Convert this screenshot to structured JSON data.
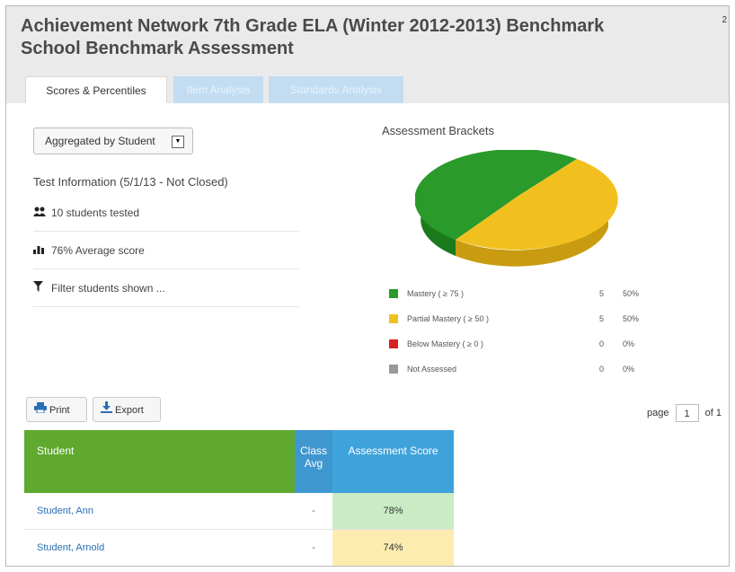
{
  "header": {
    "title_line1": "Achievement Network 7th Grade ELA (Winter 2012-2013) Benchmark",
    "title_line2": "School Benchmark Assessment",
    "corner_text": "2"
  },
  "tabs": [
    {
      "label": "Scores & Percentiles",
      "active": true
    },
    {
      "label": "Item Analysis",
      "active": false
    },
    {
      "label": "Standards Analysis",
      "active": false
    }
  ],
  "aggregate": {
    "label": "Aggregated by Student"
  },
  "test_info": {
    "title": "Test Information (5/1/13 - Not Closed)",
    "students_tested": "10 students tested",
    "average_score": "76% Average score",
    "filter": "Filter students shown ..."
  },
  "brackets": {
    "title": "Assessment Brackets",
    "items": [
      {
        "label": "Mastery ( ≥ 75 )",
        "count": "5",
        "percent": "50%",
        "color": "#2a9a2a",
        "fraction": 0.5
      },
      {
        "label": "Partial Mastery ( ≥ 50 )",
        "count": "5",
        "percent": "50%",
        "color": "#f2c01e",
        "fraction": 0.5
      },
      {
        "label": "Below Mastery ( ≥ 0 )",
        "count": "0",
        "percent": "0%",
        "color": "#d92020",
        "fraction": 0
      },
      {
        "label": "Not Assessed",
        "count": "0",
        "percent": "0%",
        "color": "#999999",
        "fraction": 0
      }
    ]
  },
  "toolbar": {
    "print_label": "Print",
    "export_label": "Export"
  },
  "pager": {
    "page_label": "page",
    "current": "1",
    "of_label": "of 1"
  },
  "table": {
    "headers": {
      "student": "Student",
      "class_avg": "Class Avg",
      "score": "Assessment Score"
    },
    "rows": [
      {
        "name": "Student, Ann",
        "class_avg": "-",
        "score": "78%",
        "color": "#c9ecc4"
      },
      {
        "name": "Student, Arnold",
        "class_avg": "-",
        "score": "74%",
        "color": "#fcecb0"
      }
    ],
    "extra_row_color": "#c9ecc4"
  },
  "icons": {
    "students": "people-icon",
    "average": "bar-chart-icon",
    "filter": "funnel-icon",
    "print": "printer-icon",
    "export": "download-icon"
  }
}
